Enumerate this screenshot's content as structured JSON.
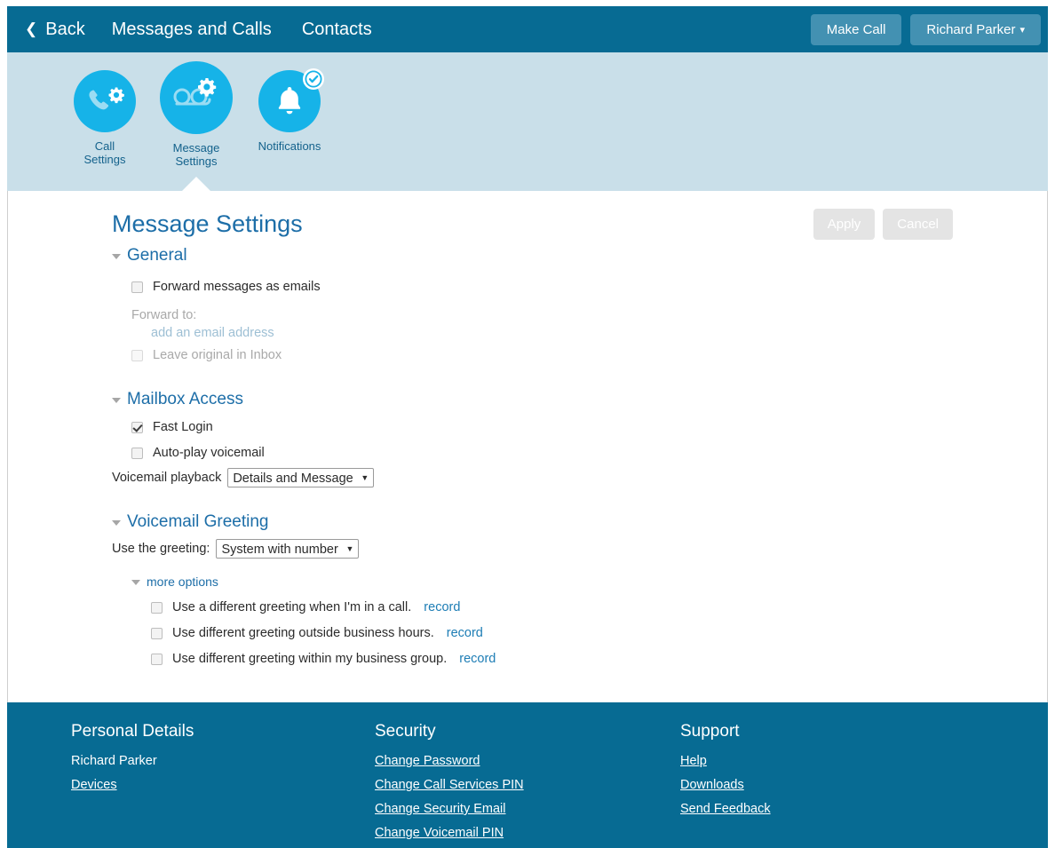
{
  "topbar": {
    "back_label": "Back",
    "back_icon": "chevron-left-icon",
    "nav_items": [
      {
        "label": "Messages and Calls"
      },
      {
        "label": "Contacts"
      }
    ],
    "make_call_label": "Make Call",
    "user_label": "Richard Parker",
    "user_caret": "▾"
  },
  "iconband": {
    "items": [
      {
        "id": "call-settings",
        "label": "Call\nSettings",
        "icon": "phone-gear-icon",
        "active": false,
        "badge": null
      },
      {
        "id": "message-settings",
        "label": "Message\nSettings",
        "icon": "voicemail-gear-icon",
        "active": true,
        "badge": null
      },
      {
        "id": "notifications",
        "label": "Notifications",
        "icon": "bell-icon",
        "active": false,
        "badge": "check-badge-icon"
      }
    ]
  },
  "main": {
    "title": "Message Settings",
    "apply_label": "Apply",
    "cancel_label": "Cancel",
    "sections": {
      "general": {
        "title": "General",
        "forward_as_emails_label": "Forward messages as emails",
        "forward_as_emails_checked": false,
        "forward_to_label": "Forward to:",
        "add_email_label": "add an email address",
        "leave_original_label": "Leave original in Inbox",
        "leave_original_checked": false
      },
      "mailbox_access": {
        "title": "Mailbox Access",
        "fast_login_label": "Fast Login",
        "fast_login_checked": true,
        "autoplay_label": "Auto-play voicemail",
        "autoplay_checked": false,
        "playback_label": "Voicemail playback",
        "playback_value": "Details and Message",
        "playback_options": [
          "Details and Message"
        ]
      },
      "voicemail_greeting": {
        "title": "Voicemail Greeting",
        "use_greeting_label": "Use the greeting:",
        "greeting_value": "System with number",
        "greeting_options": [
          "System with number"
        ],
        "more_options_label": "more options",
        "options": [
          {
            "label": "Use a different greeting when I'm in a call.",
            "record_label": "record",
            "checked": false
          },
          {
            "label": "Use different greeting outside business hours.",
            "record_label": "record",
            "checked": false
          },
          {
            "label": "Use different greeting within my business group.",
            "record_label": "record",
            "checked": false
          }
        ]
      }
    }
  },
  "footer": {
    "columns": [
      {
        "title": "Personal Details",
        "items": [
          {
            "label": "Richard Parker",
            "link": false
          },
          {
            "label": "Devices",
            "link": true
          }
        ]
      },
      {
        "title": "Security",
        "items": [
          {
            "label": "Change Password",
            "link": true
          },
          {
            "label": "Change Call Services PIN",
            "link": true
          },
          {
            "label": "Change Security Email",
            "link": true
          },
          {
            "label": "Change Voicemail PIN",
            "link": true
          }
        ]
      },
      {
        "title": "Support",
        "items": [
          {
            "label": "Help",
            "link": true
          },
          {
            "label": "Downloads",
            "link": true
          },
          {
            "label": "Send Feedback",
            "link": true
          }
        ]
      }
    ]
  },
  "colors": {
    "header_blue": "#076b93",
    "band_blue": "#c9dfe9",
    "icon_cyan": "#16b3e8",
    "link_blue": "#1d6ea8",
    "disabled_grey": "#e4e4e4"
  }
}
